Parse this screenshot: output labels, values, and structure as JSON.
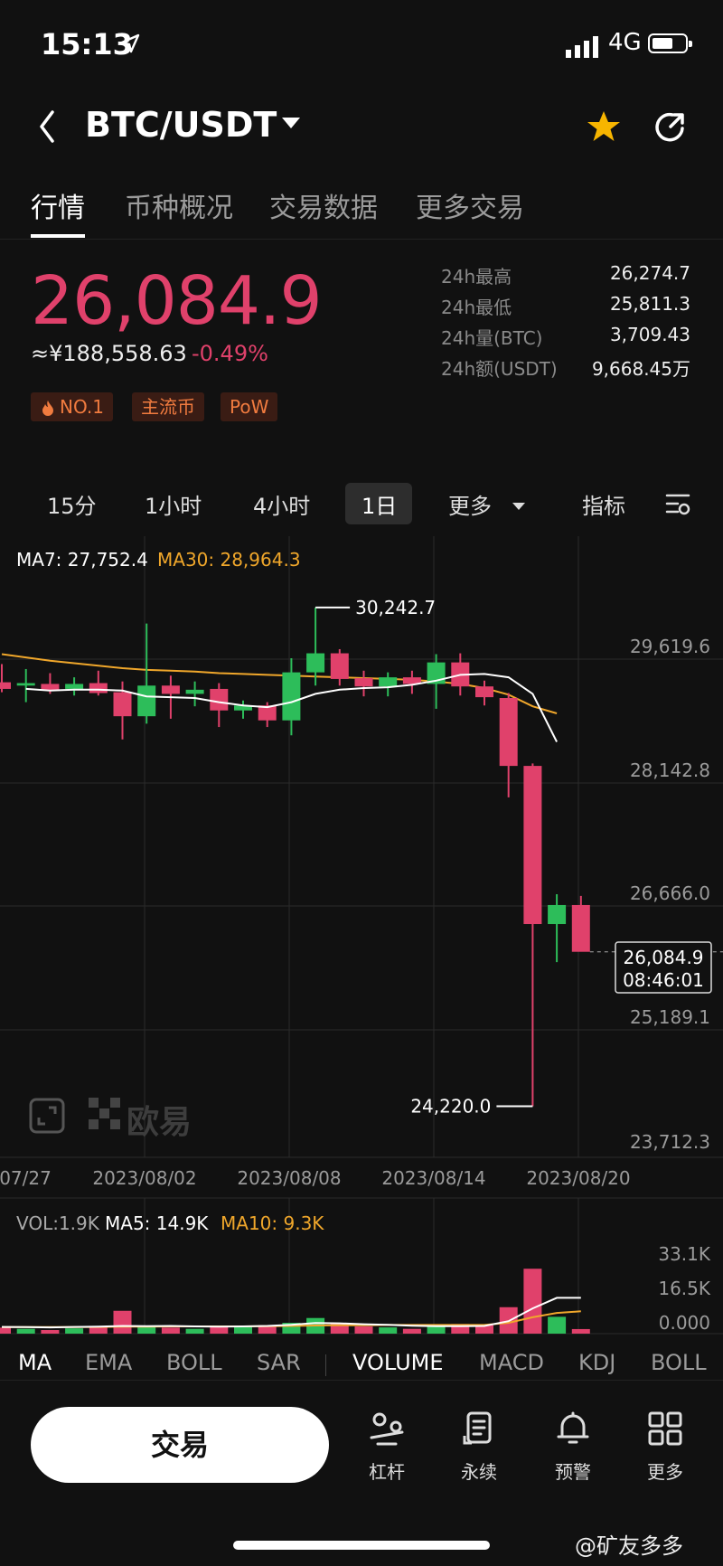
{
  "status": {
    "time": "15:13",
    "network": "4G"
  },
  "header": {
    "pair": "BTC/USDT"
  },
  "tabs": [
    "行情",
    "币种概况",
    "交易数据",
    "更多交易"
  ],
  "price": {
    "last": "26,084.9",
    "cny": "≈¥188,558.63",
    "change": "-0.49%"
  },
  "badges": [
    "NO.1",
    "主流币",
    "PoW"
  ],
  "stats": [
    {
      "label": "24h最高",
      "value": "26,274.7"
    },
    {
      "label": "24h最低",
      "value": "25,811.3"
    },
    {
      "label": "24h量(BTC)",
      "value": "3,709.43"
    },
    {
      "label": "24h额(USDT)",
      "value": "9,668.45万"
    }
  ],
  "timeframes": {
    "m15": "15分",
    "h1": "1小时",
    "h4": "4小时",
    "d1": "1日",
    "more": "更多",
    "indicators": "指标"
  },
  "legend": {
    "ma7": "MA7: 27,752.4",
    "ma30": "MA30: 28,964.3"
  },
  "vol_legend": {
    "vol": "VOL:1.9K",
    "ma5": "MA5: 14.9K",
    "ma10": "MA10: 9.3K"
  },
  "watermark": "欧易",
  "last_label": {
    "price": "26,084.9",
    "time": "08:46:01"
  },
  "indicators": [
    "MA",
    "EMA",
    "BOLL",
    "SAR",
    "VOLUME",
    "MACD",
    "KDJ",
    "BOLL"
  ],
  "bottom": {
    "trade": "交易",
    "nav": [
      "杠杆",
      "永续",
      "预警",
      "更多"
    ]
  },
  "corner_watermark": "@矿友多多",
  "colors": {
    "up": "#2dbd5a",
    "down": "#e0416b",
    "ma7": "#ffffff",
    "ma30": "#f0a72b",
    "accent": "#f7b500"
  },
  "chart_data": {
    "type": "candlestick",
    "y_ticks": [
      "29,619.6",
      "28,142.8",
      "26,666.0",
      "25,189.1",
      "23,712.3"
    ],
    "x_ticks": [
      "07/27",
      "2023/08/02",
      "2023/08/08",
      "2023/08/14",
      "2023/08/20"
    ],
    "high_label": "30,242.7",
    "low_label": "24,220.0",
    "candles": [
      {
        "o": 29340,
        "h": 29560,
        "l": 29220,
        "c": 29260
      },
      {
        "o": 29300,
        "h": 29500,
        "l": 29100,
        "c": 29330
      },
      {
        "o": 29320,
        "h": 29450,
        "l": 29200,
        "c": 29240
      },
      {
        "o": 29260,
        "h": 29400,
        "l": 29180,
        "c": 29320
      },
      {
        "o": 29330,
        "h": 29480,
        "l": 29180,
        "c": 29210
      },
      {
        "o": 29220,
        "h": 29350,
        "l": 28650,
        "c": 28930
      },
      {
        "o": 28930,
        "h": 30050,
        "l": 28840,
        "c": 29300
      },
      {
        "o": 29300,
        "h": 29420,
        "l": 28900,
        "c": 29200
      },
      {
        "o": 29200,
        "h": 29350,
        "l": 29050,
        "c": 29250
      },
      {
        "o": 29260,
        "h": 29330,
        "l": 28800,
        "c": 29000
      },
      {
        "o": 29000,
        "h": 29120,
        "l": 28900,
        "c": 29060
      },
      {
        "o": 29060,
        "h": 29100,
        "l": 28800,
        "c": 28880
      },
      {
        "o": 28880,
        "h": 29630,
        "l": 28700,
        "c": 29460
      },
      {
        "o": 29460,
        "h": 30242.7,
        "l": 29300,
        "c": 29690
      },
      {
        "o": 29690,
        "h": 29740,
        "l": 29300,
        "c": 29380
      },
      {
        "o": 29390,
        "h": 29480,
        "l": 29170,
        "c": 29290
      },
      {
        "o": 29290,
        "h": 29460,
        "l": 29170,
        "c": 29400
      },
      {
        "o": 29400,
        "h": 29480,
        "l": 29200,
        "c": 29320
      },
      {
        "o": 29320,
        "h": 29680,
        "l": 29020,
        "c": 29580
      },
      {
        "o": 29580,
        "h": 29690,
        "l": 29180,
        "c": 29290
      },
      {
        "o": 29290,
        "h": 29360,
        "l": 29060,
        "c": 29160
      },
      {
        "o": 29150,
        "h": 29210,
        "l": 27950,
        "c": 28330
      },
      {
        "o": 28330,
        "h": 28360,
        "l": 24220,
        "c": 26420
      },
      {
        "o": 26420,
        "h": 26780,
        "l": 25960,
        "c": 26650
      },
      {
        "o": 26650,
        "h": 26760,
        "l": 26450,
        "c": 26084.9
      }
    ],
    "ma7": [
      29260,
      29240,
      29250,
      29250,
      29240,
      29170,
      29160,
      29150,
      29100,
      29060,
      29040,
      29100,
      29200,
      29250,
      29270,
      29280,
      29310,
      29360,
      29430,
      29440,
      29400,
      29200,
      28620
    ],
    "ma30": [
      29680,
      29640,
      29600,
      29570,
      29540,
      29510,
      29490,
      29480,
      29470,
      29450,
      29440,
      29430,
      29420,
      29410,
      29400,
      29390,
      29380,
      29370,
      29350,
      29320,
      29270,
      29190,
      29050,
      28964.3
    ],
    "volume": {
      "ticks": [
        "33.1K",
        "16.5K",
        "0.000"
      ],
      "values": [
        2.5,
        2.0,
        1.5,
        2.2,
        3.0,
        9.5,
        2.8,
        2.5,
        2.0,
        2.8,
        3.0,
        3.5,
        4.5,
        6.5,
        4.2,
        3.0,
        2.6,
        2.0,
        3.2,
        4.0,
        3.5,
        11.0,
        27.0,
        7.0,
        1.9
      ],
      "ma5": [
        2.8,
        2.7,
        2.6,
        2.8,
        2.9,
        3.2,
        3.1,
        3.2,
        3.0,
        2.9,
        3.0,
        3.2,
        3.7,
        4.4,
        4.3,
        3.9,
        3.7,
        3.3,
        3.1,
        3.1,
        3.2,
        5.2,
        10.5,
        14.9,
        14.9
      ],
      "ma10": [
        2.7,
        2.7,
        2.7,
        2.7,
        2.8,
        2.9,
        2.9,
        3.0,
        3.0,
        3.0,
        3.0,
        3.1,
        3.2,
        3.4,
        3.5,
        3.5,
        3.6,
        3.6,
        3.6,
        3.6,
        3.6,
        4.5,
        6.8,
        8.6,
        9.3
      ]
    }
  }
}
